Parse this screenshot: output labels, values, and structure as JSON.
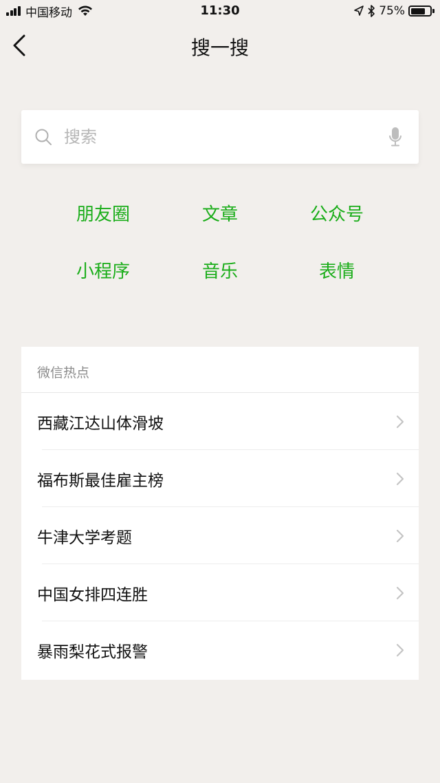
{
  "status_bar": {
    "carrier": "中国移动",
    "time": "11:30",
    "battery_percent": "75%",
    "battery_level": 0.75,
    "icons": [
      "signal-icon",
      "wifi-icon",
      "location-icon",
      "bluetooth-icon",
      "battery-icon"
    ]
  },
  "nav": {
    "title": "搜一搜",
    "back_icon": "chevron-left-icon"
  },
  "search": {
    "placeholder": "搜索",
    "value": "",
    "left_icon": "search-icon",
    "right_icon": "microphone-icon"
  },
  "categories": [
    {
      "label": "朋友圈"
    },
    {
      "label": "文章"
    },
    {
      "label": "公众号"
    },
    {
      "label": "小程序"
    },
    {
      "label": "音乐"
    },
    {
      "label": "表情"
    }
  ],
  "hot": {
    "header": "微信热点",
    "items": [
      {
        "label": "西藏江达山体滑坡"
      },
      {
        "label": "福布斯最佳雇主榜"
      },
      {
        "label": "牛津大学考题"
      },
      {
        "label": "中国女排四连胜"
      },
      {
        "label": "暴雨梨花式报警"
      }
    ]
  },
  "colors": {
    "accent_green": "#1aad19",
    "background": "#f2efec",
    "card": "#ffffff",
    "muted_text": "#8c8c8c",
    "placeholder": "#b6b6b6"
  }
}
